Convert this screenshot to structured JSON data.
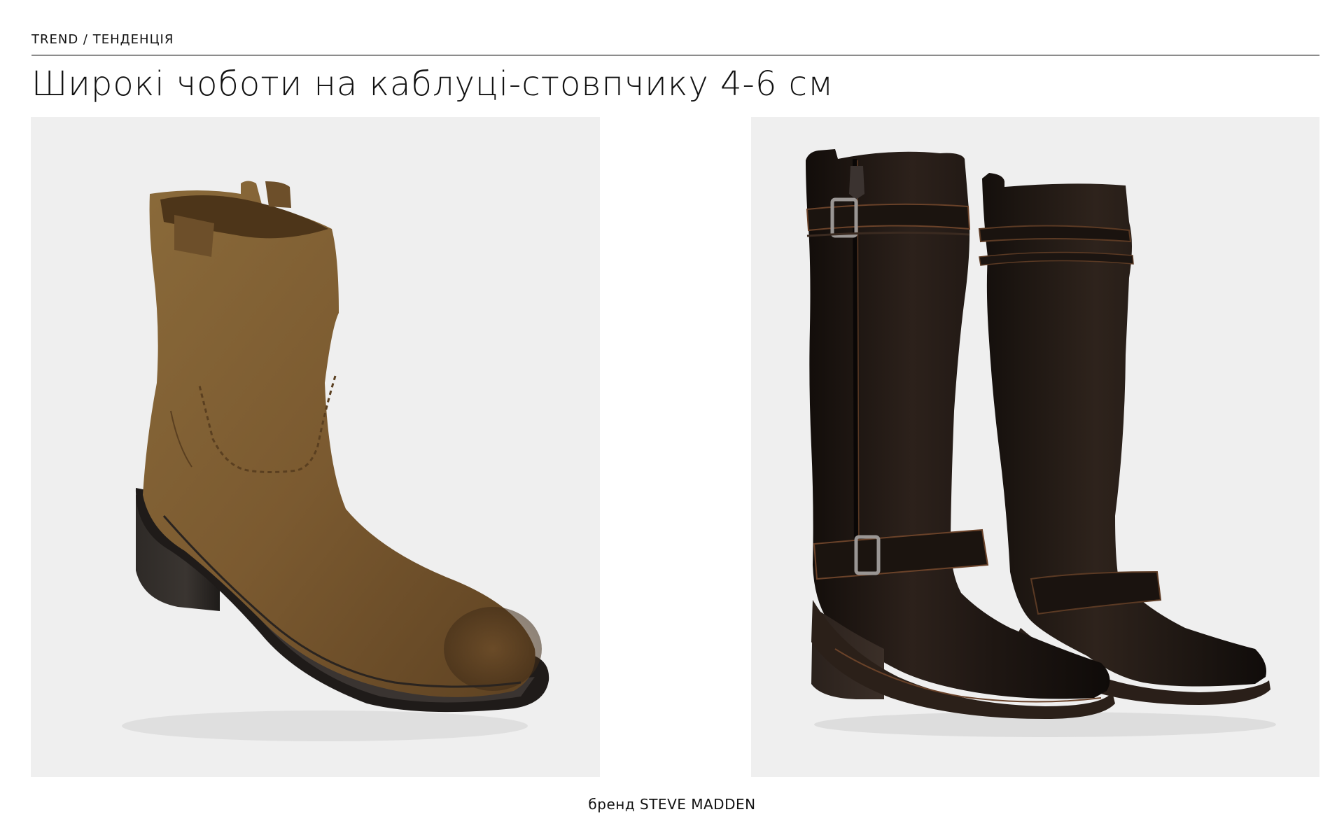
{
  "header": {
    "kicker": "TREND / ТЕНДЕНЦІЯ",
    "title": "Широкі чоботи на каблуці-стовпчику 4-6 см"
  },
  "products": [
    {
      "name": "suede-ankle-boot",
      "color": "#7d5c32"
    },
    {
      "name": "black-leather-knee-high-boots",
      "color": "#231a15"
    }
  ],
  "footer": {
    "caption": "бренд STEVE MADDEN"
  }
}
